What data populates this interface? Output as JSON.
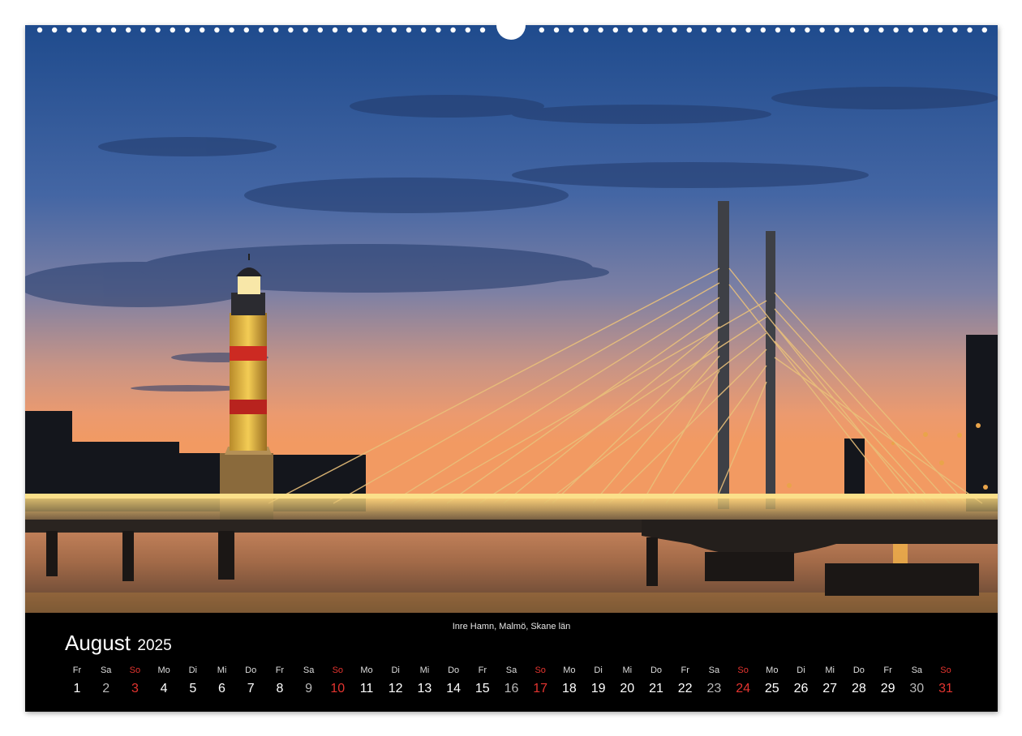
{
  "caption": "Inre Hamn, Malmö, Skane län",
  "month": "August",
  "year": "2025",
  "colors": {
    "sunday": "#e3342f",
    "saturday_number": "#b8b8b8",
    "weekday_number": "#ffffff",
    "band_background": "#000000"
  },
  "days": [
    {
      "dow": "Fr",
      "num": "1"
    },
    {
      "dow": "Sa",
      "num": "2"
    },
    {
      "dow": "So",
      "num": "3"
    },
    {
      "dow": "Mo",
      "num": "4"
    },
    {
      "dow": "Di",
      "num": "5"
    },
    {
      "dow": "Mi",
      "num": "6"
    },
    {
      "dow": "Do",
      "num": "7"
    },
    {
      "dow": "Fr",
      "num": "8"
    },
    {
      "dow": "Sa",
      "num": "9"
    },
    {
      "dow": "So",
      "num": "10"
    },
    {
      "dow": "Mo",
      "num": "11"
    },
    {
      "dow": "Di",
      "num": "12"
    },
    {
      "dow": "Mi",
      "num": "13"
    },
    {
      "dow": "Do",
      "num": "14"
    },
    {
      "dow": "Fr",
      "num": "15"
    },
    {
      "dow": "Sa",
      "num": "16"
    },
    {
      "dow": "So",
      "num": "17"
    },
    {
      "dow": "Mo",
      "num": "18"
    },
    {
      "dow": "Di",
      "num": "19"
    },
    {
      "dow": "Mi",
      "num": "20"
    },
    {
      "dow": "Do",
      "num": "21"
    },
    {
      "dow": "Fr",
      "num": "22"
    },
    {
      "dow": "Sa",
      "num": "23"
    },
    {
      "dow": "So",
      "num": "24"
    },
    {
      "dow": "Mo",
      "num": "25"
    },
    {
      "dow": "Di",
      "num": "26"
    },
    {
      "dow": "Mi",
      "num": "27"
    },
    {
      "dow": "Do",
      "num": "28"
    },
    {
      "dow": "Fr",
      "num": "29"
    },
    {
      "dow": "Sa",
      "num": "30"
    },
    {
      "dow": "So",
      "num": "31"
    }
  ]
}
